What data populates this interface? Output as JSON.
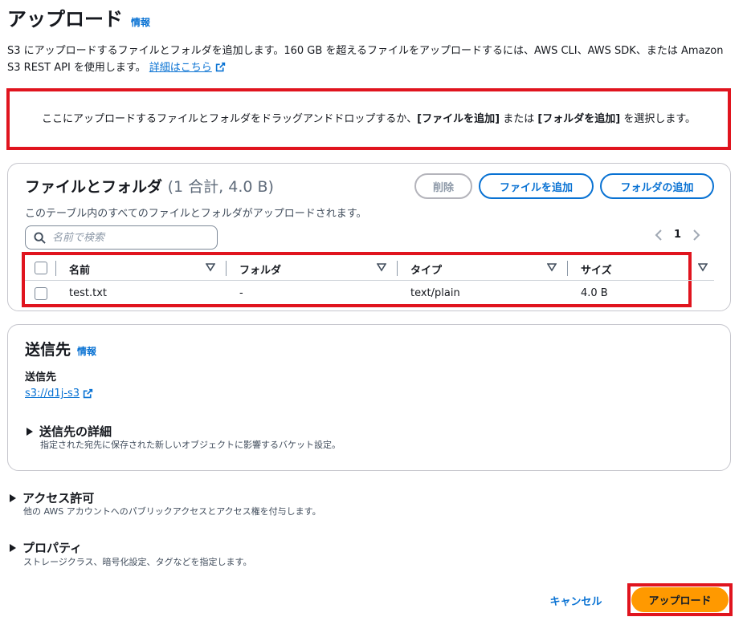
{
  "header": {
    "title": "アップロード",
    "info": "情報"
  },
  "description": {
    "text": "S3 にアップロードするファイルとフォルダを追加します。160 GB を超えるファイルをアップロードするには、AWS CLI、AWS SDK、または Amazon S3 REST API を使用します。",
    "learn_more": "詳細はこちら"
  },
  "dropzone": {
    "prefix": "ここにアップロードするファイルとフォルダをドラッグアンドドロップするか、",
    "add_files": "[ファイルを追加]",
    "middle": " または ",
    "add_folder": "[フォルダを追加]",
    "suffix": " を選択します。"
  },
  "files": {
    "title": "ファイルとフォルダ",
    "count": "(1 合計, 4.0 B)",
    "subtitle": "このテーブル内のすべてのファイルとフォルダがアップロードされます。",
    "delete_label": "削除",
    "add_files_label": "ファイルを追加",
    "add_folder_label": "フォルダの追加",
    "search_placeholder": "名前で検索",
    "page": "1",
    "columns": [
      "名前",
      "フォルダ",
      "タイプ",
      "サイズ"
    ],
    "rows": [
      {
        "name": "test.txt",
        "folder": "-",
        "type": "text/plain",
        "size": "4.0 B"
      }
    ]
  },
  "destination": {
    "title": "送信先",
    "info": "情報",
    "label": "送信先",
    "link": "s3://d1j-s3",
    "details_title": "送信先の詳細",
    "details_sub": "指定された宛先に保存された新しいオブジェクトに影響するバケット設定。"
  },
  "access": {
    "title": "アクセス許可",
    "sub": "他の AWS アカウントへのパブリックアクセスとアクセス権を付与します。"
  },
  "properties": {
    "title": "プロパティ",
    "sub": "ストレージクラス、暗号化設定、タグなどを指定します。"
  },
  "footer": {
    "cancel_label": "キャンセル",
    "upload_label": "アップロード"
  },
  "colors": {
    "accent": "#0972d3",
    "highlight": "#e0141e",
    "primary_button": "#ff9900"
  }
}
